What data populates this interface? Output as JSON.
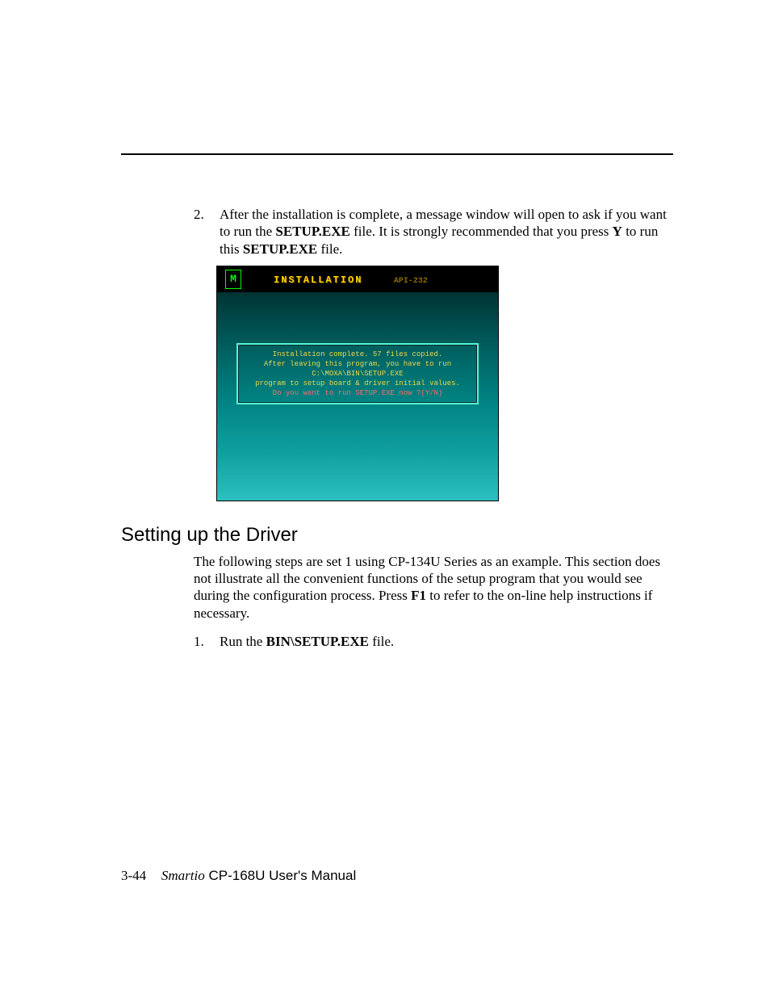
{
  "step2": {
    "marker": "2.",
    "pre": "After the installation is complete, a message window will open to ask if you want to run the ",
    "bold1": "SETUP.EXE",
    "mid1": " file. It is strongly recommended that you press ",
    "bold2": "Y",
    "mid2": " to run this ",
    "bold3": "SETUP.EXE",
    "post": " file."
  },
  "screenshot": {
    "logo": "M",
    "title": "INSTALLATION",
    "sub": "API-232",
    "dialog": {
      "l1": "Installation complete. 57 files copied.",
      "l2": "After leaving this program, you have to run",
      "l3": "C:\\MOXA\\BIN\\SETUP.EXE",
      "l4": "program to setup board & driver initial values.",
      "l5": "Do you want to run SETUP.EXE now ?(Y/N)"
    }
  },
  "section_heading": "Setting up the Driver",
  "section_body": {
    "pre": "The following steps are set 1 using CP-134U Series as an example. This section does not illustrate all the convenient functions of the setup program that you would see during the configuration process. Press ",
    "bold": "F1",
    "post": " to refer to the on-line help instructions if necessary."
  },
  "step1": {
    "marker": "1.",
    "pre": "Run the ",
    "bold": "BIN\\SETUP.EXE",
    "post": " file."
  },
  "footer": {
    "page": "3-44",
    "brand": "Smartio",
    "doc": " CP-168U User's Manual"
  }
}
